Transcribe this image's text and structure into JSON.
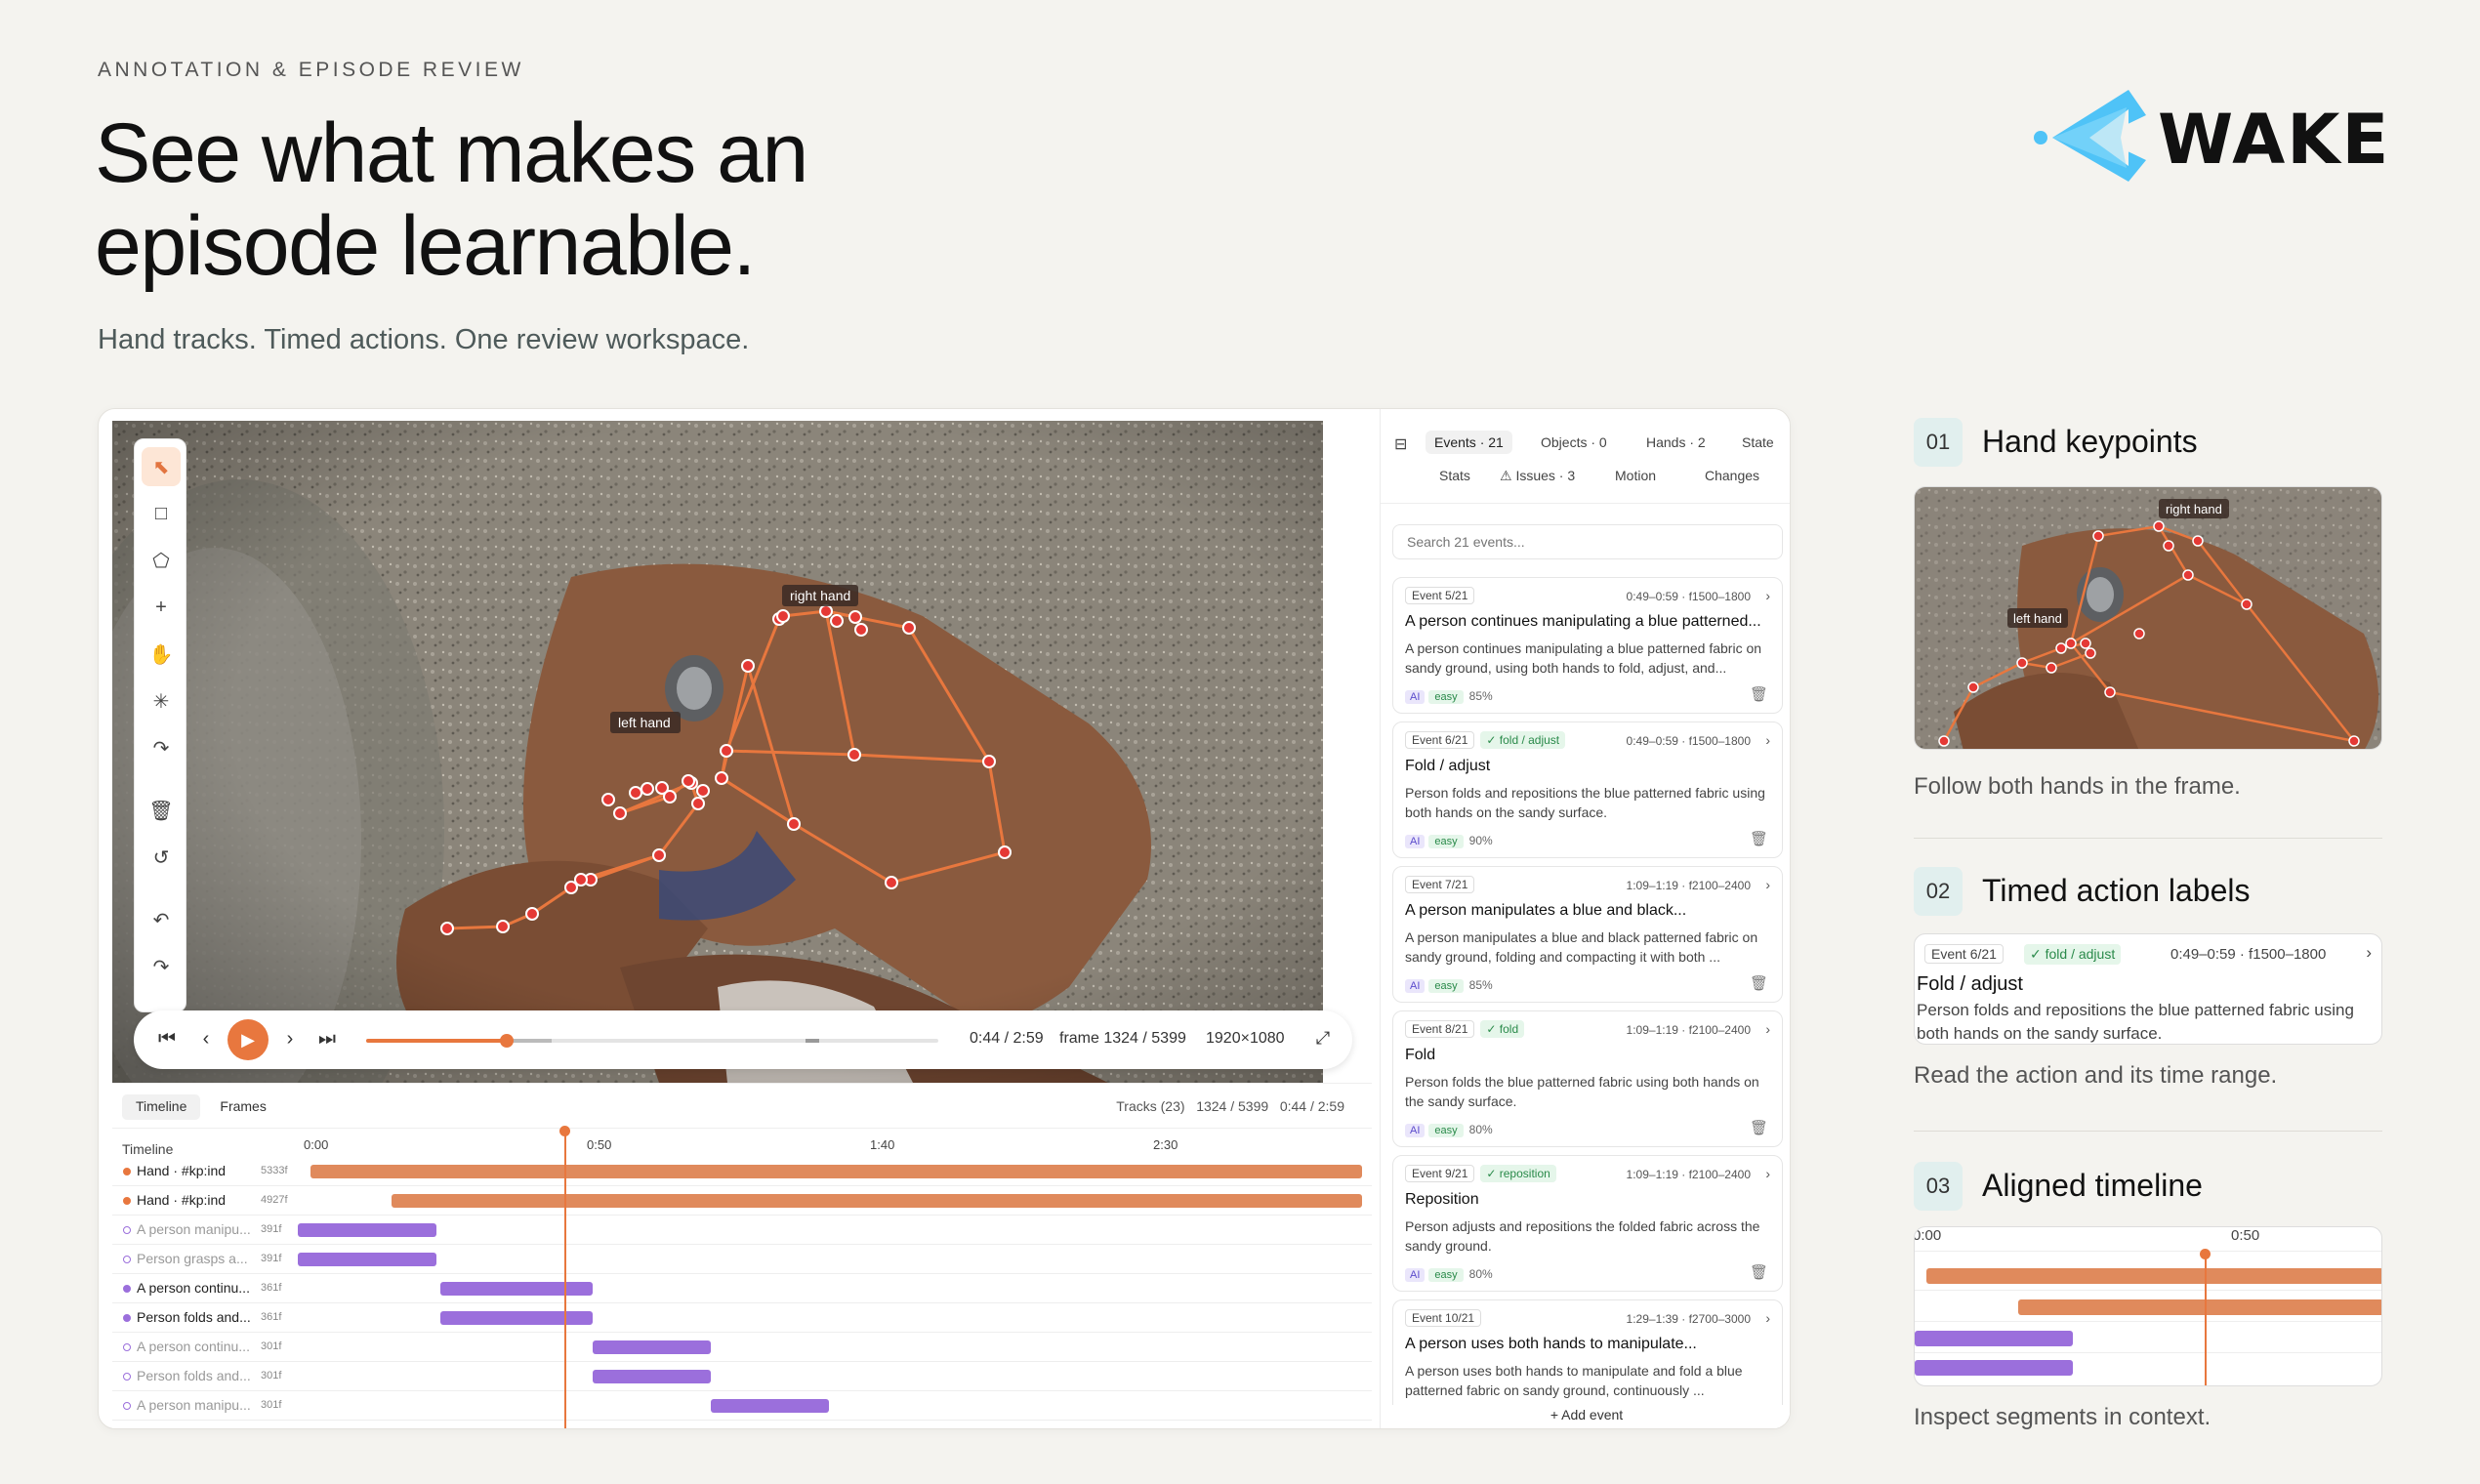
{
  "header": {
    "eyebrow": "ANNOTATION & EPISODE REVIEW",
    "headline_line1": "See what makes an",
    "headline_line2": "episode learnable.",
    "subline": "Hand tracks. Timed actions. One review workspace."
  },
  "brand": {
    "name": "WAKE",
    "accent": "#4fc3f7"
  },
  "colors": {
    "orange": "#e8773e",
    "purple": "#9b6fdc"
  },
  "toolbar": {
    "tools": [
      "cursor-icon",
      "square-icon",
      "polygon-icon",
      "plus-icon",
      "hand-icon",
      "magic-icon",
      "redo-arrow-icon",
      "trash-icon",
      "reset-icon",
      "undo-icon",
      "redo-icon"
    ]
  },
  "video": {
    "labels": {
      "right_hand": "right hand",
      "left_hand": "left hand"
    }
  },
  "player": {
    "time": "0:44 / 2:59",
    "frame": "frame 1324 / 5399",
    "resolution": "1920×1080",
    "progress": 0.245
  },
  "timeline": {
    "tabs": [
      "Timeline",
      "Frames"
    ],
    "info": "Tracks (23)   1324 / 5399   0:44 / 2:59",
    "header_label": "Timeline",
    "ticks": [
      "0:00",
      "0:50",
      "1:40",
      "2:30"
    ],
    "rows": [
      {
        "name": "Hand · #kp:ind",
        "count": "5333f",
        "color": "#e8773e",
        "filled": true,
        "muted": false,
        "start": 0.012,
        "end": 1.0
      },
      {
        "name": "Hand · #kp:ind",
        "count": "4927f",
        "color": "#e8773e",
        "filled": true,
        "muted": false,
        "start": 0.088,
        "end": 1.0
      },
      {
        "name": "A person manipu...",
        "count": "391f",
        "color": "#9b6fdc",
        "filled": false,
        "muted": true,
        "start": 0.0,
        "end": 0.13
      },
      {
        "name": "Person grasps a...",
        "count": "391f",
        "color": "#9b6fdc",
        "filled": false,
        "muted": true,
        "start": 0.0,
        "end": 0.13
      },
      {
        "name": "A person continu...",
        "count": "361f",
        "color": "#9b6fdc",
        "filled": true,
        "muted": false,
        "start": 0.134,
        "end": 0.277
      },
      {
        "name": "Person folds and...",
        "count": "361f",
        "color": "#9b6fdc",
        "filled": true,
        "muted": false,
        "start": 0.134,
        "end": 0.277
      },
      {
        "name": "A person continu...",
        "count": "301f",
        "color": "#9b6fdc",
        "filled": false,
        "muted": true,
        "start": 0.277,
        "end": 0.388
      },
      {
        "name": "Person folds and...",
        "count": "301f",
        "color": "#9b6fdc",
        "filled": false,
        "muted": true,
        "start": 0.277,
        "end": 0.388
      },
      {
        "name": "A person manipu...",
        "count": "301f",
        "color": "#9b6fdc",
        "filled": false,
        "muted": true,
        "start": 0.388,
        "end": 0.499
      }
    ]
  },
  "panel": {
    "tabs": {
      "events": "Events · 21",
      "objects": "Objects · 0",
      "hands": "Hands · 2",
      "state": "State",
      "stats": "Stats",
      "issues": "Issues · 3",
      "motion": "Motion",
      "changes": "Changes"
    },
    "search_placeholder": "Search 21 events...",
    "events": [
      {
        "id": "Event 5/21",
        "tag": "",
        "time": "0:49–0:59 · f1500–1800",
        "title": "A person continues manipulating a blue patterned...",
        "desc": "A person continues manipulating a blue patterned fabric on sandy ground, using both hands to fold, adjust, and...",
        "ai": "AI",
        "difficulty": "easy",
        "pct": "85%"
      },
      {
        "id": "Event 6/21",
        "tag": "✓ fold / adjust",
        "time": "0:49–0:59 · f1500–1800",
        "title": "Fold / adjust",
        "desc": "Person folds and repositions the blue patterned fabric using both hands on the sandy surface.",
        "ai": "AI",
        "difficulty": "easy",
        "pct": "90%"
      },
      {
        "id": "Event 7/21",
        "tag": "",
        "time": "1:09–1:19 · f2100–2400",
        "title": "A person manipulates a blue and black...",
        "desc": "A person manipulates a blue and black patterned fabric on sandy ground, folding and compacting it with both ...",
        "ai": "AI",
        "difficulty": "easy",
        "pct": "85%"
      },
      {
        "id": "Event 8/21",
        "tag": "✓ fold",
        "time": "1:09–1:19 · f2100–2400",
        "title": "Fold",
        "desc": "Person folds the blue patterned fabric using both hands on the sandy surface.",
        "ai": "AI",
        "difficulty": "easy",
        "pct": "80%"
      },
      {
        "id": "Event 9/21",
        "tag": "✓ reposition",
        "time": "1:09–1:19 · f2100–2400",
        "title": "Reposition",
        "desc": "Person adjusts and repositions the folded fabric across the sandy ground.",
        "ai": "AI",
        "difficulty": "easy",
        "pct": "80%"
      },
      {
        "id": "Event 10/21",
        "tag": "",
        "time": "1:29–1:39 · f2700–3000",
        "title": "A person uses both hands to manipulate...",
        "desc": "A person uses both hands to manipulate and fold a blue patterned fabric on sandy ground, continuously ...",
        "ai": "",
        "difficulty": "",
        "pct": ""
      }
    ],
    "add_event": "+ Add event"
  },
  "features": [
    {
      "num": "01",
      "title": "Hand keypoints",
      "caption": "Follow both hands in the frame."
    },
    {
      "num": "02",
      "title": "Timed action labels",
      "caption": "Read the action and its time range."
    },
    {
      "num": "03",
      "title": "Aligned timeline",
      "caption": "Inspect segments in context."
    }
  ],
  "feature_card": {
    "id": "Event 6/21",
    "tag": "✓ fold / adjust",
    "time": "0:49–0:59 · f1500–1800",
    "title": "Fold / adjust",
    "desc": "Person folds and repositions the blue patterned fabric using both hands on the sandy surface."
  },
  "mini_timeline": {
    "ticks": [
      "0:00",
      "0:50"
    ]
  }
}
